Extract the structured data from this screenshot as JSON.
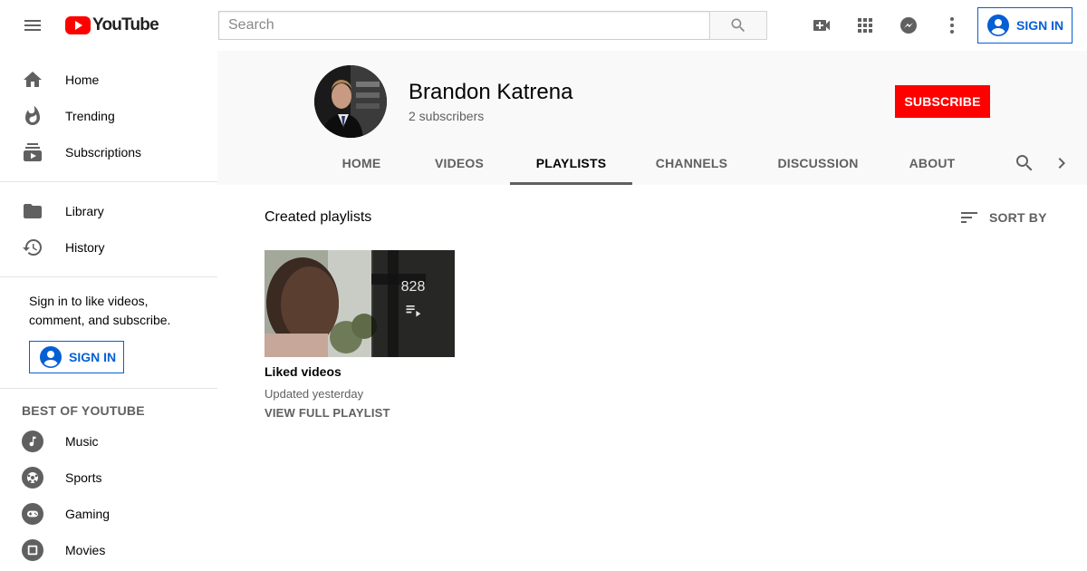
{
  "header": {
    "logo_text": "YouTube",
    "search_placeholder": "Search",
    "search_value": "",
    "signin_label": "SIGN IN",
    "brand_color": "#ff0000",
    "accent_color": "#065fd4"
  },
  "sidebar": {
    "main_items": [
      {
        "label": "Home",
        "icon": "home-icon"
      },
      {
        "label": "Trending",
        "icon": "fire-icon"
      },
      {
        "label": "Subscriptions",
        "icon": "subscriptions-icon"
      }
    ],
    "library_items": [
      {
        "label": "Library",
        "icon": "folder-icon"
      },
      {
        "label": "History",
        "icon": "history-icon"
      }
    ],
    "signin_prompt": "Sign in to like videos, comment, and subscribe.",
    "signin_label": "SIGN IN",
    "section_title": "BEST OF YOUTUBE",
    "best_items": [
      {
        "label": "Music",
        "icon": "music-icon"
      },
      {
        "label": "Sports",
        "icon": "sports-icon"
      },
      {
        "label": "Gaming",
        "icon": "gaming-icon"
      },
      {
        "label": "Movies",
        "icon": "movies-icon"
      }
    ]
  },
  "channel": {
    "name": "Brandon Katrena",
    "subscribers": "2 subscribers",
    "subscribe_label": "SUBSCRIBE",
    "tabs": [
      {
        "label": "HOME"
      },
      {
        "label": "VIDEOS"
      },
      {
        "label": "PLAYLISTS",
        "active": true
      },
      {
        "label": "CHANNELS"
      },
      {
        "label": "DISCUSSION"
      },
      {
        "label": "ABOUT"
      }
    ]
  },
  "content": {
    "section_title": "Created playlists",
    "sort_label": "SORT BY",
    "playlists": [
      {
        "title": "Liked videos",
        "count": "828",
        "updated": "Updated yesterday",
        "view_label": "VIEW FULL PLAYLIST"
      }
    ]
  }
}
